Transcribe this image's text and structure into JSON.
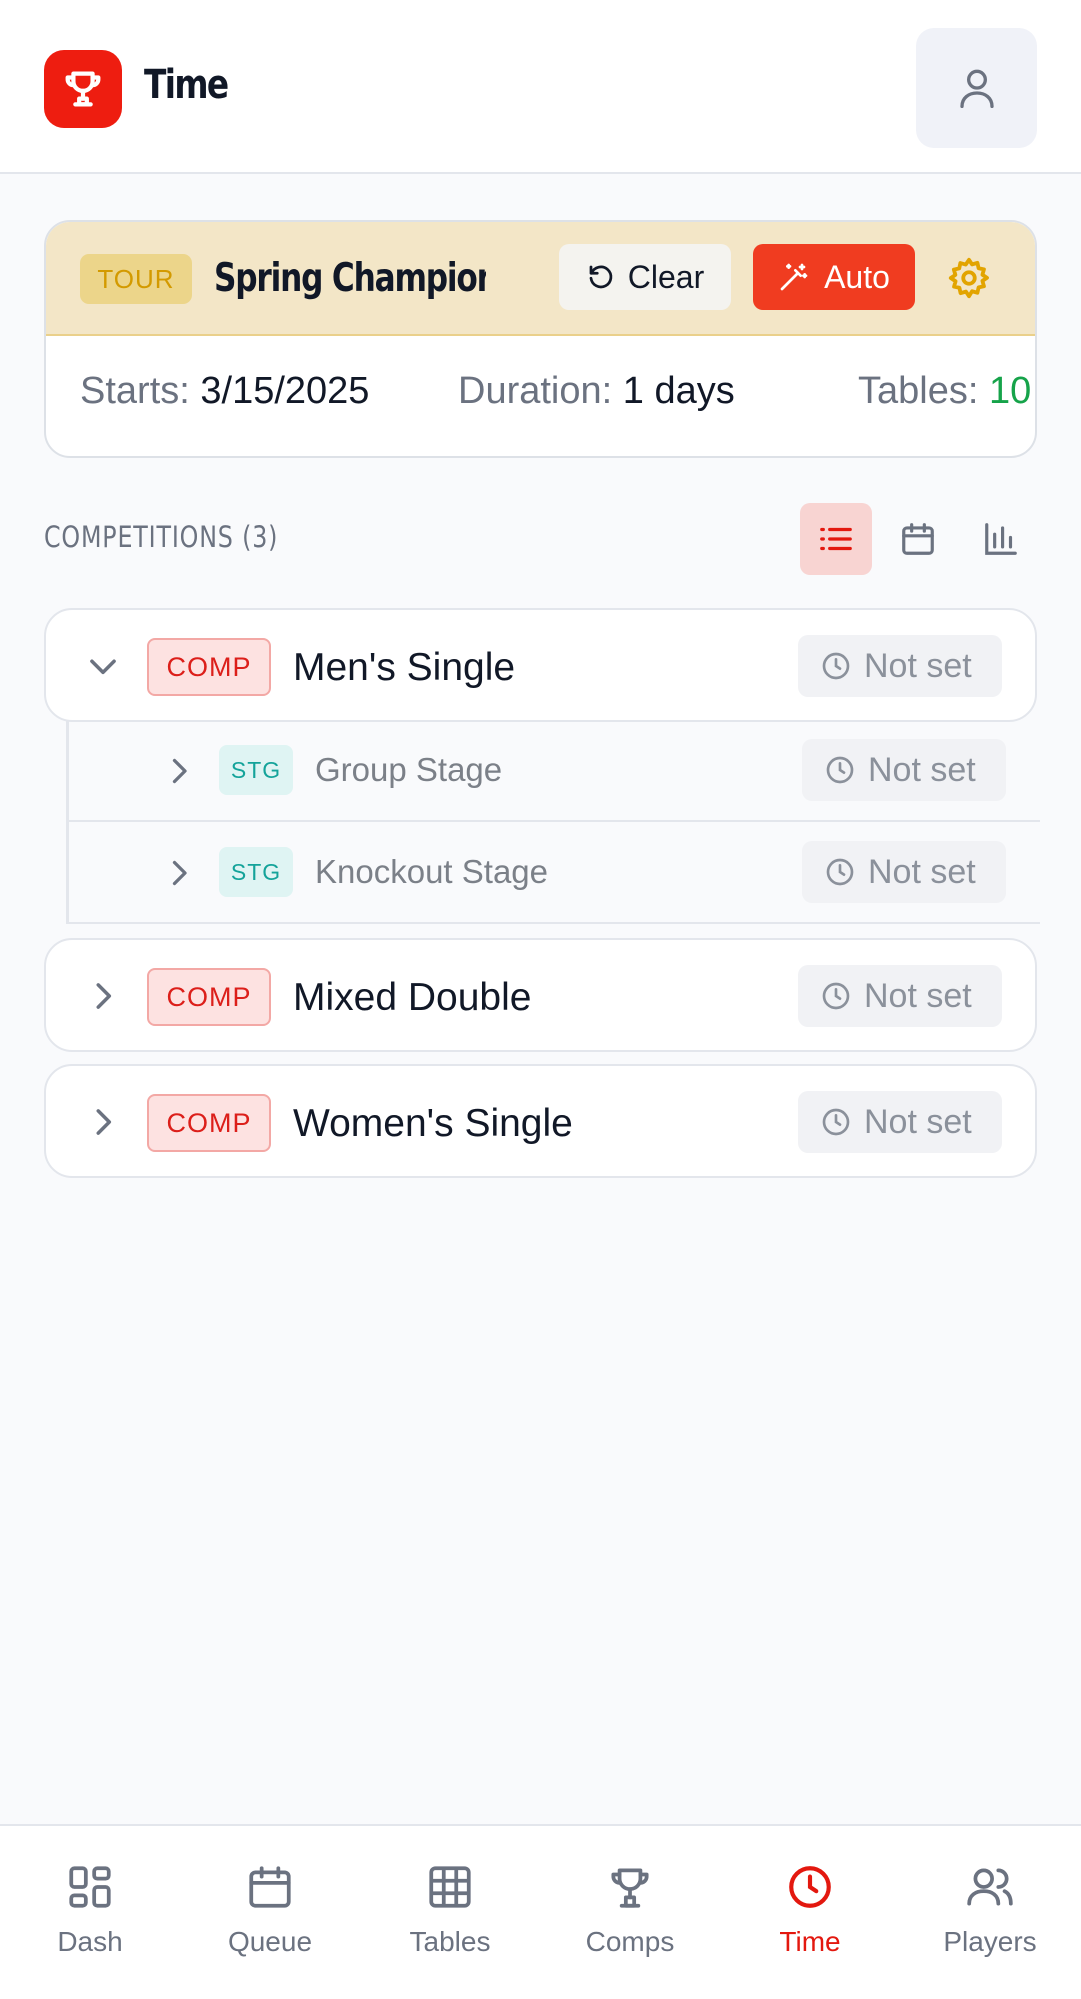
{
  "header": {
    "title": "Time",
    "logo_icon": "trophy-icon",
    "profile_icon": "user-icon"
  },
  "tournament": {
    "badge": "TOUR",
    "name": "Spring Champions...",
    "clear_label": "Clear",
    "auto_label": "Auto",
    "starts_label": "Starts:",
    "starts_value": "3/15/2025",
    "duration_label": "Duration:",
    "duration_value": "1 days",
    "tables_label": "Tables:",
    "tables_value": "10"
  },
  "competitions_section": {
    "label": "COMPETITIONS (3)",
    "views": [
      "list-icon",
      "calendar-icon",
      "chart-icon"
    ],
    "active_view": "list"
  },
  "competitions": [
    {
      "badge": "COMP",
      "name": "Men's Single",
      "time": "Not set",
      "expanded": true,
      "stages": [
        {
          "badge": "STG",
          "name": "Group Stage",
          "time": "Not set"
        },
        {
          "badge": "STG",
          "name": "Knockout Stage",
          "time": "Not set"
        }
      ]
    },
    {
      "badge": "COMP",
      "name": "Mixed Double",
      "time": "Not set",
      "expanded": false
    },
    {
      "badge": "COMP",
      "name": "Women's Single",
      "time": "Not set",
      "expanded": false
    }
  ],
  "nav": [
    {
      "label": "Dash",
      "icon": "dashboard-icon"
    },
    {
      "label": "Queue",
      "icon": "calendar-icon"
    },
    {
      "label": "Tables",
      "icon": "grid-icon"
    },
    {
      "label": "Comps",
      "icon": "trophy-icon"
    },
    {
      "label": "Time",
      "icon": "clock-icon",
      "active": true
    },
    {
      "label": "Players",
      "icon": "users-icon"
    }
  ],
  "colors": {
    "accent": "#ee1d10",
    "tour_header_bg": "#f3e6c7",
    "tour_badge_text": "#d39a00",
    "stage_badge_text": "#14a39a",
    "tables_value": "#16a34a"
  }
}
